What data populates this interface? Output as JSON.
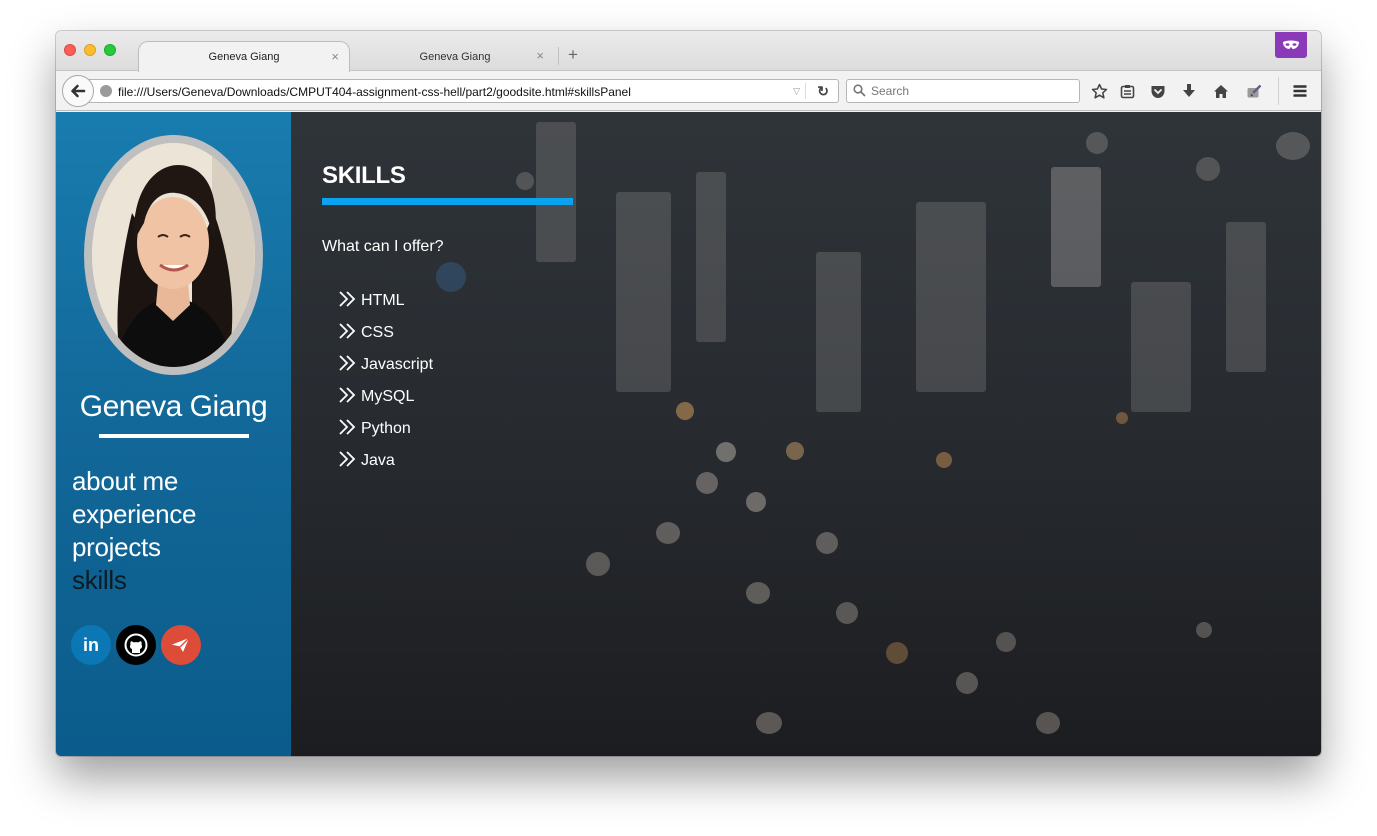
{
  "browser": {
    "tabs": [
      {
        "title": "Geneva Giang",
        "close": "×",
        "active": true
      },
      {
        "title": "Geneva Giang",
        "close": "×",
        "active": false
      }
    ],
    "new_tab": "+",
    "url": "file:///Users/Geneva/Downloads/CMPUT404-assignment-css-hell/part2/goodsite.html#skillsPanel",
    "search_placeholder": "Search",
    "private_mask_color": "#8a3ab9",
    "toolbar_icons": [
      "star-icon",
      "reading-list-icon",
      "pocket-icon",
      "download-icon",
      "home-icon",
      "sync-icon",
      "menu-icon"
    ]
  },
  "sidebar": {
    "name": "Geneva Giang",
    "nav": [
      {
        "label": "about me"
      },
      {
        "label": "experience"
      },
      {
        "label": "projects"
      },
      {
        "label": "skills",
        "current": true
      }
    ],
    "socials": [
      {
        "label": "in",
        "name": "linkedin",
        "color": "#0b77b5"
      },
      {
        "name": "github",
        "color": "#000000"
      },
      {
        "name": "email",
        "color": "#dd4b39"
      }
    ],
    "accent_color": "#1686bf"
  },
  "main": {
    "heading": "SKILLS",
    "heading_rule_color": "#0aa3f0",
    "subtitle": "What can I offer?",
    "skills": [
      "HTML",
      "CSS",
      "Javascript",
      "MySQL",
      "Python",
      "Java"
    ]
  }
}
